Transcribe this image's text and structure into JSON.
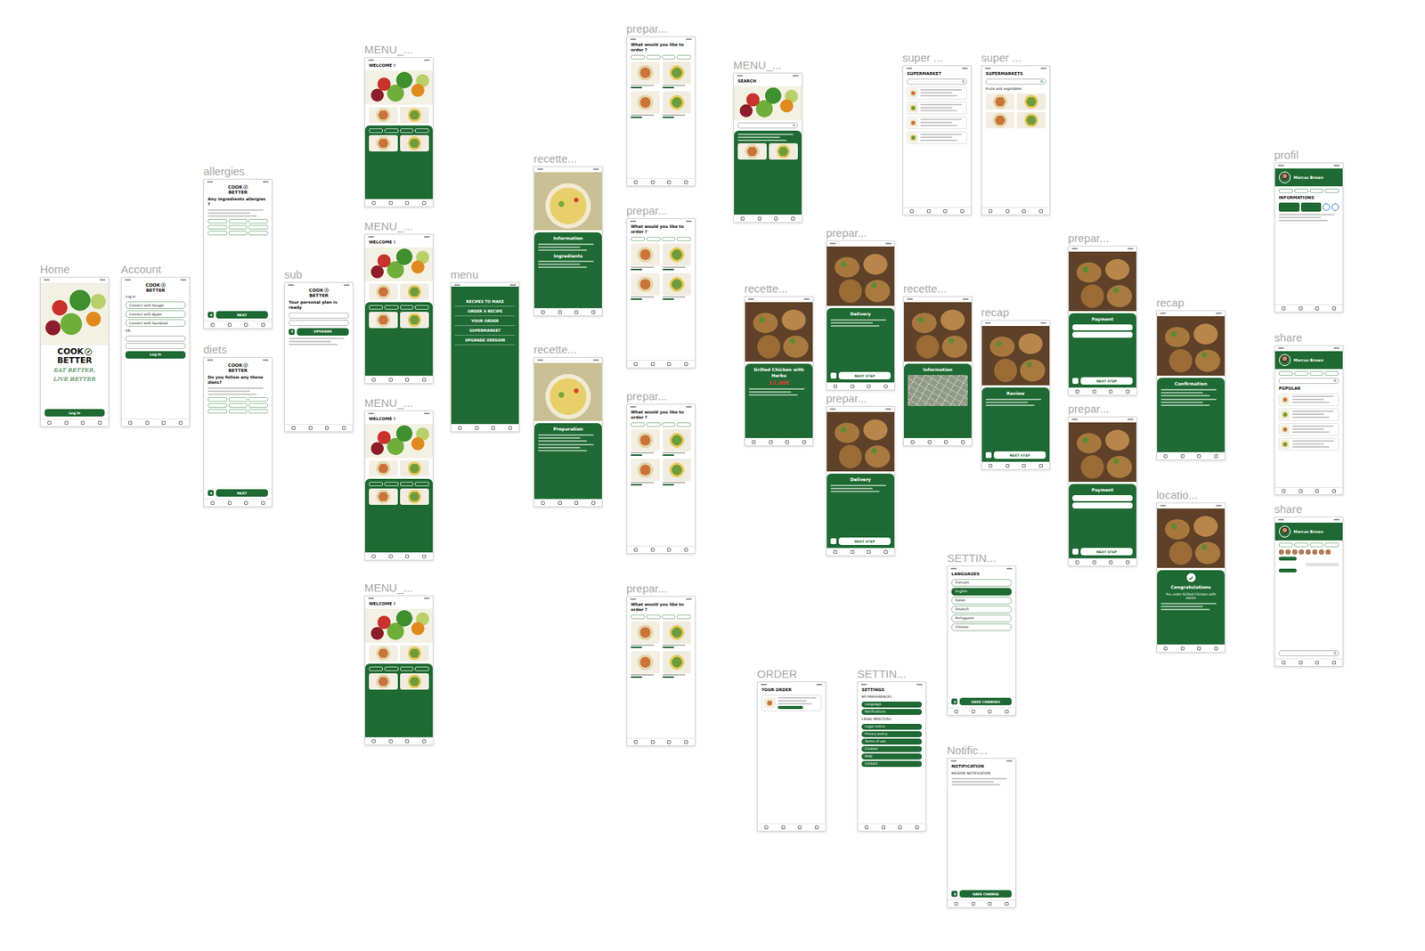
{
  "canvas": {
    "frames": [
      {
        "label": "Home",
        "top": [
          {
            "kind": "photo",
            "look": "veg-large"
          },
          {
            "kind": "logo-large",
            "word1": "COOK",
            "word2": "BETTER"
          },
          {
            "kind": "tagline",
            "text": "EAT BETTER,"
          },
          {
            "kind": "tagline",
            "text": "LIVE BETTER"
          },
          {
            "kind": "spacer"
          },
          {
            "kind": "button",
            "text": "Log In",
            "back": false
          }
        ]
      },
      {
        "label": "Account",
        "top": [
          {
            "kind": "logo",
            "word1": "COOK",
            "word2": "BETTER"
          },
          {
            "kind": "text",
            "text": "Log In"
          },
          {
            "kind": "outline-list",
            "items": [
              {
                "label": "Connect with Google",
                "selected": false
              },
              {
                "label": "Connect with Apple",
                "selected": false
              },
              {
                "label": "Connect with Facebook",
                "selected": false
              }
            ]
          },
          {
            "kind": "text",
            "text": "OR"
          },
          {
            "kind": "fields"
          },
          {
            "kind": "button",
            "text": "Log In",
            "back": false
          }
        ]
      },
      {
        "label": "allergies",
        "top": [
          {
            "kind": "logo",
            "word1": "COOK",
            "word2": "BETTER"
          },
          {
            "kind": "heading",
            "text": "Any ingredients allergies ?"
          },
          {
            "kind": "lines"
          },
          {
            "kind": "chips"
          },
          {
            "kind": "spacer"
          },
          {
            "kind": "button",
            "text": "NEXT",
            "back": true
          }
        ]
      },
      {
        "label": "diets",
        "top": [
          {
            "kind": "logo",
            "word1": "COOK",
            "word2": "BETTER"
          },
          {
            "kind": "heading",
            "text": "Do you follow any these diets?"
          },
          {
            "kind": "lines"
          },
          {
            "kind": "chips"
          },
          {
            "kind": "spacer"
          },
          {
            "kind": "button",
            "text": "NEXT",
            "back": true
          }
        ]
      },
      {
        "label": "sub",
        "top": [
          {
            "kind": "logo",
            "word1": "COOK",
            "word2": "BETTER"
          },
          {
            "kind": "heading",
            "text": "Your personal plan is ready"
          },
          {
            "kind": "fields"
          },
          {
            "kind": "button",
            "text": "UPGRADE",
            "back": true
          },
          {
            "kind": "lines"
          },
          {
            "kind": "spacer"
          }
        ]
      },
      {
        "label": "MENU_...",
        "top": [
          {
            "kind": "heading",
            "text": "WELCOME !"
          },
          {
            "kind": "photo",
            "look": "veg"
          },
          {
            "kind": "thumbs"
          }
        ],
        "bottom": [
          {
            "kind": "tabs"
          },
          {
            "kind": "thumbs"
          }
        ]
      },
      {
        "label": "MENU_...",
        "top": [
          {
            "kind": "heading",
            "text": "WELCOME !"
          },
          {
            "kind": "photo",
            "look": "veg"
          },
          {
            "kind": "thumbs"
          }
        ],
        "bottom": [
          {
            "kind": "tabs"
          },
          {
            "kind": "thumbs"
          }
        ]
      },
      {
        "label": "MENU_...",
        "top": [
          {
            "kind": "heading",
            "text": "WELCOME !"
          },
          {
            "kind": "photo",
            "look": "veg"
          },
          {
            "kind": "thumbs"
          }
        ],
        "bottom": [
          {
            "kind": "tabs"
          },
          {
            "kind": "thumbs"
          }
        ]
      },
      {
        "label": "MENU_...",
        "top": [
          {
            "kind": "heading",
            "text": "WELCOME !"
          },
          {
            "kind": "photo",
            "look": "veg"
          },
          {
            "kind": "thumbs"
          }
        ],
        "bottom": [
          {
            "kind": "tabs"
          },
          {
            "kind": "thumbs"
          }
        ]
      },
      {
        "label": "menu",
        "top": [],
        "bottom": [
          {
            "kind": "menu-list",
            "items": [
              "RECIPES TO MAKE",
              "ORDER A RECIPE",
              "YOUR ORDER",
              "SUPERMARKET",
              "UPGRADE VERSION"
            ]
          }
        ]
      },
      {
        "label": "recette...",
        "top": [
          {
            "kind": "photo",
            "look": "salad"
          }
        ],
        "bottom": [
          {
            "kind": "heading",
            "text": "Information"
          },
          {
            "kind": "lines"
          },
          {
            "kind": "heading",
            "text": "Ingredients"
          },
          {
            "kind": "lines"
          }
        ]
      },
      {
        "label": "recette...",
        "top": [
          {
            "kind": "photo",
            "look": "salad"
          }
        ],
        "bottom": [
          {
            "kind": "heading",
            "text": "Preparation"
          },
          {
            "kind": "lines"
          },
          {
            "kind": "lines"
          }
        ]
      },
      {
        "label": "prepar...",
        "top": [
          {
            "kind": "heading",
            "text": "What would you like to order ?"
          },
          {
            "kind": "tabs"
          },
          {
            "kind": "dishgrid"
          }
        ]
      },
      {
        "label": "prepar...",
        "top": [
          {
            "kind": "heading",
            "text": "What would you like to order ?"
          },
          {
            "kind": "tabs"
          },
          {
            "kind": "dishgrid"
          }
        ]
      },
      {
        "label": "prepar...",
        "top": [
          {
            "kind": "heading",
            "text": "What would you like to order ?"
          },
          {
            "kind": "tabs"
          },
          {
            "kind": "dishgrid"
          }
        ]
      },
      {
        "label": "prepar...",
        "top": [
          {
            "kind": "heading",
            "text": "What would you like to order ?"
          },
          {
            "kind": "tabs"
          },
          {
            "kind": "dishgrid"
          }
        ]
      },
      {
        "label": "MENU_...",
        "top": [
          {
            "kind": "heading",
            "text": "SEARCH"
          },
          {
            "kind": "photo",
            "look": "veg"
          },
          {
            "kind": "field"
          }
        ],
        "bottom": [
          {
            "kind": "lines"
          },
          {
            "kind": "thumbs"
          }
        ]
      },
      {
        "label": "recette...",
        "top": [
          {
            "kind": "photo",
            "look": "chicken"
          }
        ],
        "bottom": [
          {
            "kind": "heading",
            "text": "Grilled Chicken with Herbs"
          },
          {
            "kind": "price",
            "text": "12,00€"
          },
          {
            "kind": "lines"
          }
        ]
      },
      {
        "label": "prepar...",
        "top": [
          {
            "kind": "photo",
            "look": "chicken"
          }
        ],
        "bottom": [
          {
            "kind": "heading",
            "text": "Delivery"
          },
          {
            "kind": "lines"
          },
          {
            "kind": "spacer"
          },
          {
            "kind": "button",
            "text": "NEXT STEP",
            "back": true
          }
        ]
      },
      {
        "label": "prepar...",
        "top": [
          {
            "kind": "photo",
            "look": "chicken"
          }
        ],
        "bottom": [
          {
            "kind": "heading",
            "text": "Delivery"
          },
          {
            "kind": "lines"
          },
          {
            "kind": "spacer"
          },
          {
            "kind": "button",
            "text": "NEXT STEP",
            "back": true
          }
        ]
      },
      {
        "label": "recette...",
        "top": [
          {
            "kind": "photo",
            "look": "chicken"
          }
        ],
        "bottom": [
          {
            "kind": "heading",
            "text": "Information"
          },
          {
            "kind": "map"
          }
        ]
      },
      {
        "label": "super ...",
        "top": [
          {
            "kind": "heading",
            "text": "SUPERMARKET"
          },
          {
            "kind": "field"
          },
          {
            "kind": "shoplist"
          }
        ]
      },
      {
        "label": "super ...",
        "top": [
          {
            "kind": "heading",
            "text": "SUPERMARKETS"
          },
          {
            "kind": "field"
          },
          {
            "kind": "text",
            "text": "Fruits and vegetables"
          },
          {
            "kind": "thumbs"
          },
          {
            "kind": "thumbs"
          }
        ]
      },
      {
        "label": "recap",
        "top": [
          {
            "kind": "photo",
            "look": "chicken"
          }
        ],
        "bottom": [
          {
            "kind": "heading",
            "text": "Review"
          },
          {
            "kind": "lines"
          },
          {
            "kind": "spacer"
          },
          {
            "kind": "button",
            "text": "NEXT STEP",
            "back": true
          }
        ]
      },
      {
        "label": "prepar...",
        "top": [
          {
            "kind": "photo",
            "look": "chicken"
          }
        ],
        "bottom": [
          {
            "kind": "heading",
            "text": "Payment"
          },
          {
            "kind": "fields"
          },
          {
            "kind": "spacer"
          },
          {
            "kind": "button",
            "text": "NEXT STEP",
            "back": true
          }
        ]
      },
      {
        "label": "prepar...",
        "top": [
          {
            "kind": "photo",
            "look": "chicken"
          }
        ],
        "bottom": [
          {
            "kind": "heading",
            "text": "Payment"
          },
          {
            "kind": "fields"
          },
          {
            "kind": "spacer"
          },
          {
            "kind": "button",
            "text": "NEXT STEP",
            "back": true
          }
        ]
      },
      {
        "label": "recap",
        "top": [
          {
            "kind": "photo",
            "look": "chicken"
          }
        ],
        "bottom": [
          {
            "kind": "heading",
            "text": "Confirmation"
          },
          {
            "kind": "lines"
          },
          {
            "kind": "lines"
          }
        ]
      },
      {
        "label": "locatio...",
        "top": [
          {
            "kind": "photo",
            "look": "chicken"
          }
        ],
        "bottom": [
          {
            "kind": "check"
          },
          {
            "kind": "heading",
            "text": "Congratulations"
          },
          {
            "kind": "text",
            "text": "You order Grilled Chicken with Herbs"
          },
          {
            "kind": "lines"
          }
        ]
      },
      {
        "label": "SETTIN...",
        "top": [
          {
            "kind": "heading",
            "text": "LANGUAGES"
          },
          {
            "kind": "outline-list",
            "items": [
              {
                "label": "Français",
                "selected": false
              },
              {
                "label": "English",
                "selected": true
              },
              {
                "label": "Italian",
                "selected": false
              },
              {
                "label": "Deutsch",
                "selected": false
              },
              {
                "label": "Portuguese",
                "selected": false
              },
              {
                "label": "Chinese",
                "selected": false
              }
            ]
          },
          {
            "kind": "spacer"
          },
          {
            "kind": "button",
            "text": "SAVE CHANGES",
            "back": true
          }
        ]
      },
      {
        "label": "Notific...",
        "top": [
          {
            "kind": "heading",
            "text": "NOTIFICATION"
          },
          {
            "kind": "text",
            "text": "RECEIVE NOTIFICATION"
          },
          {
            "kind": "lines"
          },
          {
            "kind": "spacer"
          },
          {
            "kind": "button",
            "text": "SAVE CHANGE",
            "back": true
          }
        ]
      },
      {
        "label": "ORDER",
        "top": [
          {
            "kind": "heading",
            "text": "YOUR ORDER"
          },
          {
            "kind": "order-card"
          },
          {
            "kind": "spacer"
          }
        ]
      },
      {
        "label": "SETTIN...",
        "top": [
          {
            "kind": "heading",
            "text": "SETTINGS"
          },
          {
            "kind": "text",
            "text": "MY PREFERENCES"
          },
          {
            "kind": "pills",
            "items": [
              "Language",
              "Notifications"
            ]
          },
          {
            "kind": "text",
            "text": "LEGAL MENTIONS"
          },
          {
            "kind": "pills",
            "items": [
              "Legal notice",
              "Privacy policy",
              "Terms of use",
              "Cookies",
              "Help",
              "Contact"
            ]
          },
          {
            "kind": "spacer"
          }
        ]
      },
      {
        "label": "profil",
        "top": [
          {
            "kind": "profile-header",
            "name": "Marcus Brown"
          },
          {
            "kind": "tabs"
          },
          {
            "kind": "heading",
            "text": "INFORMATIONS"
          },
          {
            "kind": "stats"
          },
          {
            "kind": "lines"
          },
          {
            "kind": "spacer"
          }
        ]
      },
      {
        "label": "share",
        "top": [
          {
            "kind": "profile-header",
            "name": "Marcus Brown"
          },
          {
            "kind": "tabs"
          },
          {
            "kind": "field"
          },
          {
            "kind": "heading",
            "text": "POPULAR"
          },
          {
            "kind": "shoplist"
          }
        ]
      },
      {
        "label": "share",
        "top": [
          {
            "kind": "profile-header",
            "name": "Marcus Brown"
          },
          {
            "kind": "tabs"
          },
          {
            "kind": "avatars"
          },
          {
            "kind": "chat"
          },
          {
            "kind": "spacer"
          },
          {
            "kind": "field"
          }
        ]
      }
    ]
  }
}
